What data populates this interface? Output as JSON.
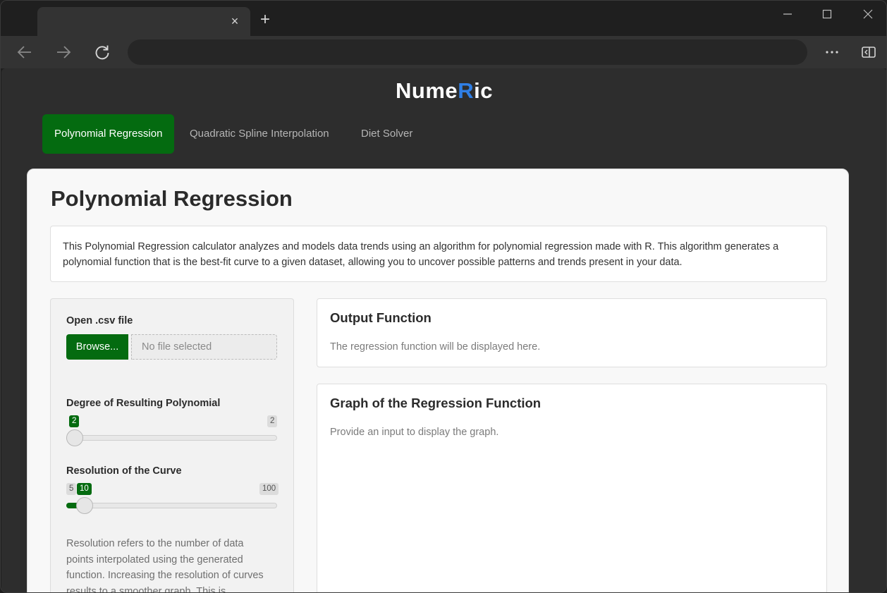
{
  "browser": {
    "new_tab_symbol": "+",
    "close_tab_symbol": "×"
  },
  "app": {
    "brand_prefix": "Nume",
    "brand_accent": "R",
    "brand_suffix": "ic",
    "accent_color": "#2f7fe6",
    "primary_color": "#046b10"
  },
  "nav": {
    "tabs": [
      {
        "label": "Polynomial Regression",
        "active": true
      },
      {
        "label": "Quadratic Spline Interpolation",
        "active": false
      },
      {
        "label": "Diet Solver",
        "active": false
      }
    ]
  },
  "main": {
    "title": "Polynomial Regression",
    "description": "This Polynomial Regression calculator analyzes and models data trends using an algorithm for polynomial regression made with R. This algorithm generates a polynomial function that is the best-fit curve to a given dataset, allowing you to uncover possible patterns and trends present in your data."
  },
  "sidebar": {
    "file_label": "Open .csv file",
    "browse_label": "Browse...",
    "file_placeholder": "No file selected",
    "degree": {
      "label": "Degree of Resulting Polynomial",
      "value": "2",
      "max": "2",
      "fraction": 0
    },
    "resolution": {
      "label": "Resolution of the Curve",
      "min": "5",
      "value": "10",
      "max": "100",
      "fraction": 0.0526
    },
    "help_text": "Resolution refers to the number of data points interpolated using the generated function. Increasing the resolution of curves results to a smoother graph. This is especially"
  },
  "output": {
    "title": "Output Function",
    "text": "The regression function will be displayed here."
  },
  "graph": {
    "title": "Graph of the Regression Function",
    "text": "Provide an input to display the graph."
  }
}
